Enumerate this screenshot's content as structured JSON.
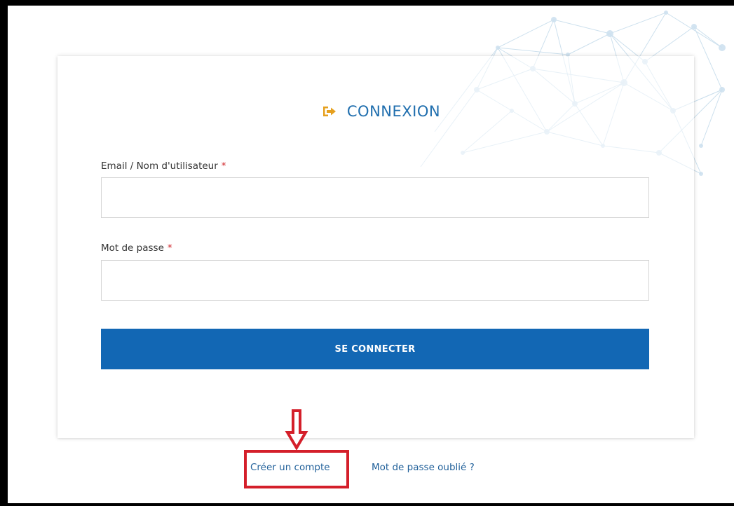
{
  "login": {
    "title": "CONNEXION",
    "title_icon": "sign-in-icon",
    "accent_color": "#e6a01e",
    "primary_color": "#1267b4"
  },
  "fields": {
    "email": {
      "label": "Email / Nom d'utilisateur",
      "required_marker": "*",
      "value": "",
      "placeholder": ""
    },
    "password": {
      "label": "Mot de passe",
      "required_marker": "*",
      "value": "",
      "placeholder": ""
    }
  },
  "submit": {
    "label": "SE CONNECTER"
  },
  "links": {
    "create_account": "Créer un compte",
    "forgot_password": "Mot de passe oublié ?"
  },
  "annotation": {
    "highlight_color": "#d41f2a",
    "arrow_icon": "down-arrow-icon"
  }
}
